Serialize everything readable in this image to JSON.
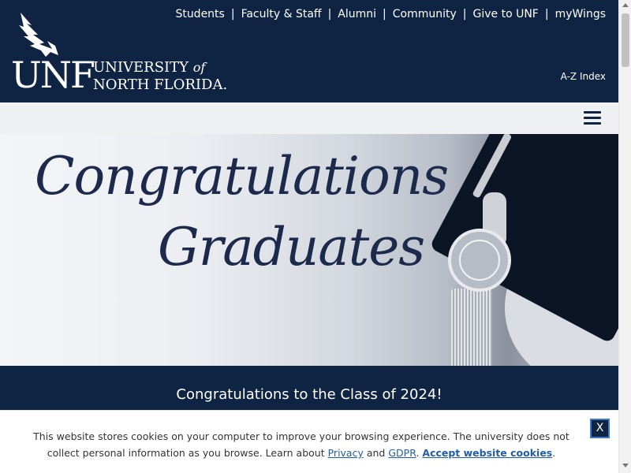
{
  "header": {
    "logo": {
      "unf": "UNF",
      "line1_a": "UNIVERSITY",
      "line1_b": "of",
      "line2": "NORTH FLORIDA."
    },
    "topnav": [
      "Students",
      "Faculty & Staff",
      "Alumni",
      "Community",
      "Give to UNF",
      "myWings"
    ],
    "separator": "|",
    "az_index": "A-Z Index",
    "bg_color": "#0f2443"
  },
  "menu": {
    "icon": "hamburger-menu-icon"
  },
  "hero": {
    "line1": "Congratulations",
    "line2": "Graduates"
  },
  "banner": {
    "text": "Congratulations to the Class of 2024!"
  },
  "cookie": {
    "text_before": "This website stores cookies on your computer to improve your browsing experience. The university does not collect personal information as you browse. Learn about ",
    "privacy": "Privacy",
    "and": " and ",
    "gdpr": "GDPR",
    "period": ". ",
    "accept": "Accept website cookies",
    "end": ".",
    "close": "X"
  }
}
